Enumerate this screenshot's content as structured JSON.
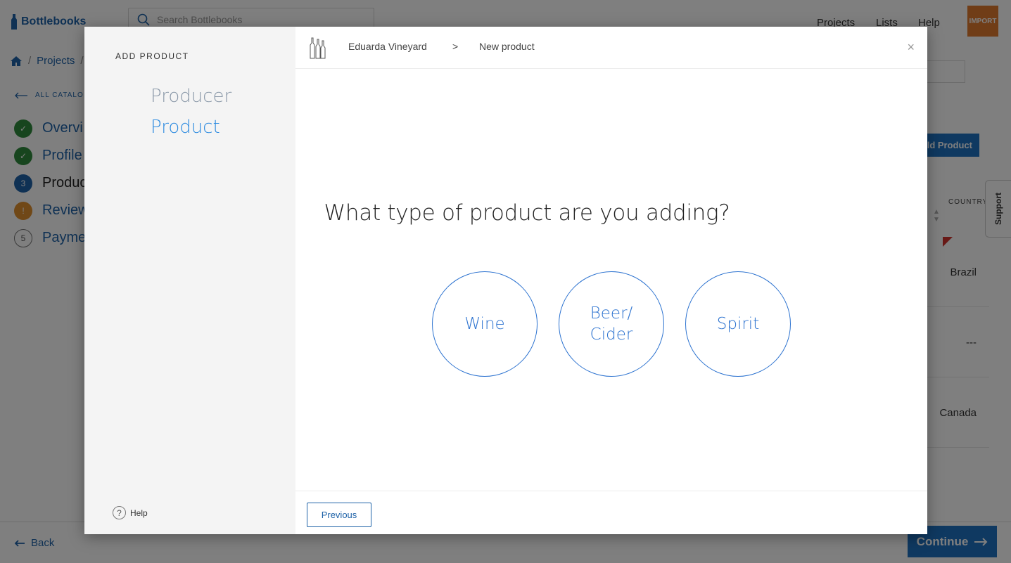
{
  "app": {
    "logo_text": "Bottlebooks",
    "search_placeholder": "Search Bottlebooks",
    "nav": [
      "Projects",
      "Lists",
      "Help"
    ],
    "import_label": "IMPORT"
  },
  "breadcrumb": {
    "items": [
      "Projects"
    ]
  },
  "catalogue": {
    "all_label": "ALL CATALO",
    "steps": [
      {
        "marker": "✓",
        "label": "Overvi",
        "status": "done"
      },
      {
        "marker": "✓",
        "label": "Profile",
        "status": "done"
      },
      {
        "marker": "3",
        "label": "Produc",
        "status": "current"
      },
      {
        "marker": "!",
        "label": "Review",
        "status": "warning"
      },
      {
        "marker": "5",
        "label": "Payme",
        "status": "todo"
      }
    ]
  },
  "table": {
    "add_product_label": "ld Product",
    "country_header": "COUNTRY",
    "rows": [
      "Brazil",
      "---",
      "Canada"
    ]
  },
  "support_label": "Support",
  "footer": {
    "back_label": "Back",
    "continue_label": "Continue"
  },
  "modal": {
    "side_title": "ADD PRODUCT",
    "side_steps": [
      "Producer",
      "Product"
    ],
    "help_label": "Help",
    "header": {
      "producer": "Eduarda Vineyard",
      "separator": ">",
      "current": "New product",
      "close": "×"
    },
    "question": "What type of product are you adding?",
    "choices": [
      "Wine",
      "Beer/\nCider",
      "Spirit"
    ],
    "previous_label": "Previous"
  },
  "colors": {
    "brand": "#1f63a8",
    "accent": "#2d73d0",
    "success": "#2f8a3d",
    "warning": "#e0912f",
    "import": "#e07a2f"
  }
}
